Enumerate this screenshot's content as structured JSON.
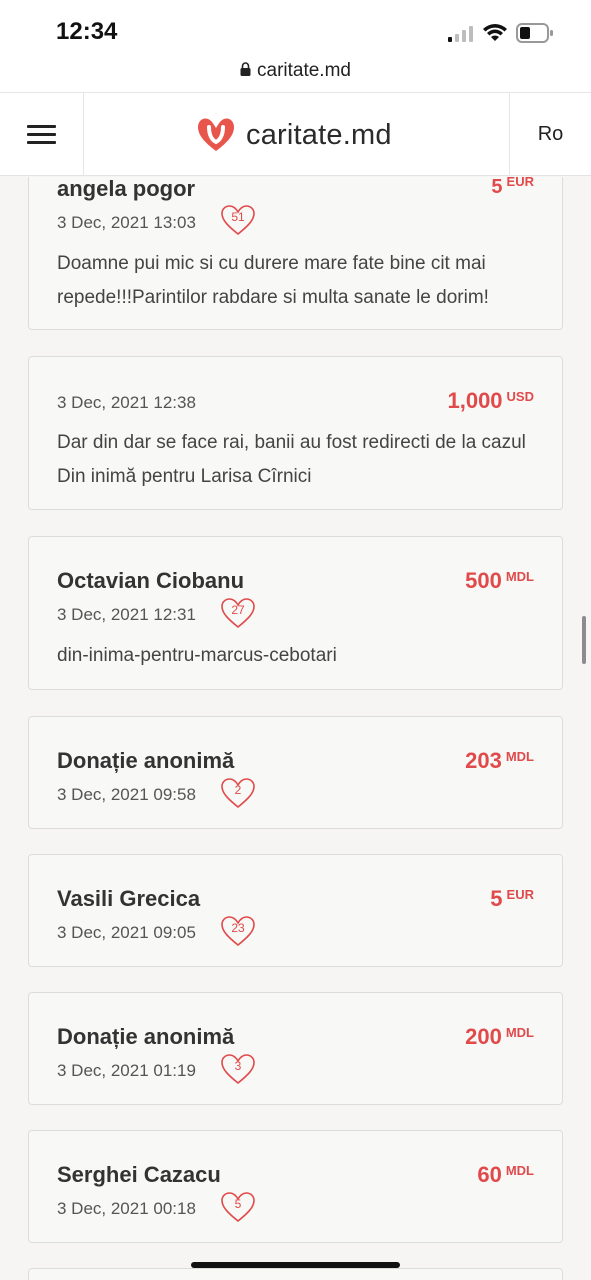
{
  "status_bar": {
    "time": "12:34"
  },
  "browser": {
    "url": "caritate.md"
  },
  "header": {
    "logo_text": "caritate.md",
    "language": "Ro"
  },
  "donations": [
    {
      "name": "angela pogor",
      "date": "3 Dec, 2021 13:03",
      "hearts": "51",
      "amount": "5",
      "currency": "EUR",
      "message": "Doamne pui mic si cu durere mare fate bine cit mai repede!!!Parintilor rabdare si multa sanate le dorim!"
    },
    {
      "name": "",
      "date": "3 Dec, 2021 12:38",
      "hearts": "",
      "amount": "1,000",
      "currency": "USD",
      "message": "Dar din dar se face rai, banii au fost redirecti de la cazul Din inimă pentru Larisa Cîrnici"
    },
    {
      "name": "Octavian Ciobanu",
      "date": "3 Dec, 2021 12:31",
      "hearts": "27",
      "amount": "500",
      "currency": "MDL",
      "message": "din-inima-pentru-marcus-cebotari"
    },
    {
      "name": "Donație anonimă",
      "date": "3 Dec, 2021 09:58",
      "hearts": "2",
      "amount": "203",
      "currency": "MDL",
      "message": ""
    },
    {
      "name": "Vasili Grecica",
      "date": "3 Dec, 2021 09:05",
      "hearts": "23",
      "amount": "5",
      "currency": "EUR",
      "message": ""
    },
    {
      "name": "Donație anonimă",
      "date": "3 Dec, 2021 01:19",
      "hearts": "3",
      "amount": "200",
      "currency": "MDL",
      "message": ""
    },
    {
      "name": "Serghei Cazacu",
      "date": "3 Dec, 2021 00:18",
      "hearts": "5",
      "amount": "60",
      "currency": "MDL",
      "message": ""
    }
  ],
  "colors": {
    "accent": "#e04a4a",
    "background": "#f6f5f3",
    "card_border": "#dcdcdc"
  }
}
